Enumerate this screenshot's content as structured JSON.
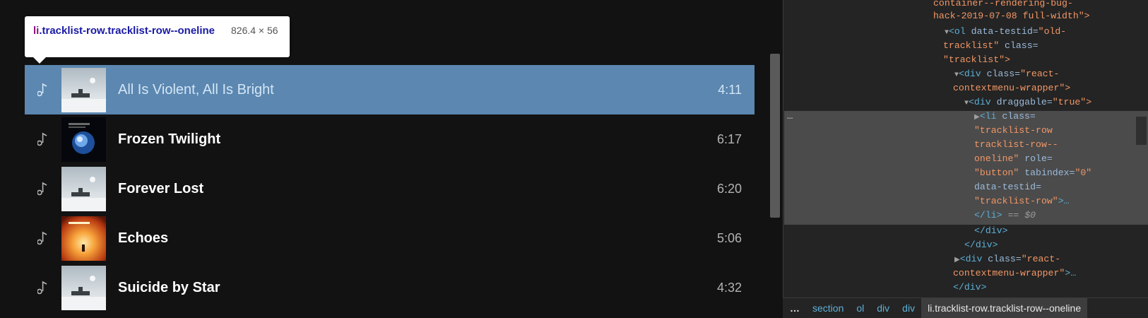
{
  "tooltip": {
    "tag": "li",
    "selector": ".tracklist-row.tracklist-row--oneline",
    "size": "826.4 × 56"
  },
  "tracks": [
    {
      "title": "All Is Violent, All Is Bright",
      "duration": "4:11",
      "highlighted": true,
      "cover": "snow-cover"
    },
    {
      "title": "Frozen Twilight",
      "duration": "6:17",
      "highlighted": false,
      "cover": "planet-cover"
    },
    {
      "title": "Forever Lost",
      "duration": "6:20",
      "highlighted": false,
      "cover": "snow-cover"
    },
    {
      "title": "Echoes",
      "duration": "5:06",
      "highlighted": false,
      "cover": "fire-cover"
    },
    {
      "title": "Suicide by Star",
      "duration": "4:32",
      "highlighted": false,
      "cover": "snow-cover"
    }
  ],
  "dom": {
    "l0": "container--rendering-bug-",
    "l1": "hack-2019-07-08 full-width\">",
    "ol_tag": "<ol",
    "ol_attr1": " data-testid=",
    "ol_val1": "\"old-",
    "ol_val1b": "tracklist\"",
    "ol_attr2": " class=",
    "ol_val2": "\"tracklist\">",
    "div1_tag": "<div",
    "div1_attr": " class=",
    "div1_val": "\"react-",
    "div1_valb": "contextmenu-wrapper\">",
    "div2_tag": "<div",
    "div2_attr": " draggable=",
    "div2_val": "\"true\">",
    "li_tag": "<li",
    "li_attr": " class=",
    "li_val1": "\"tracklist-row",
    "li_val2": "tracklist-row--",
    "li_val3": "oneline\"",
    "li_attr2": " role=",
    "li_val4": "\"button\"",
    "li_attr3": " tabindex=",
    "li_val5": "\"0\"",
    "li_attr4": "data-testid=",
    "li_val6": "\"tracklist-row\"",
    "li_end": ">…",
    "li_close": "</li>",
    "li_eq": " == $0",
    "close_div_a": "</div>",
    "close_div_b": "</div>",
    "div3_tag": "<div",
    "div3_attr": " class=",
    "div3_val": "\"react-",
    "div3_valb": "contextmenu-wrapper\"",
    "div3_end": ">…",
    "close_div_c": "</div>",
    "gutter_dots": "…"
  },
  "breadcrumb": {
    "more": "…",
    "items": [
      "section",
      "ol",
      "div",
      "div"
    ],
    "selected": "li.tracklist-row.tracklist-row--oneline"
  },
  "colors": {
    "highlight": "#6fa8dc",
    "devtools_bg": "#242424",
    "tag": "#5db0d7",
    "attr_value": "#f29766"
  }
}
